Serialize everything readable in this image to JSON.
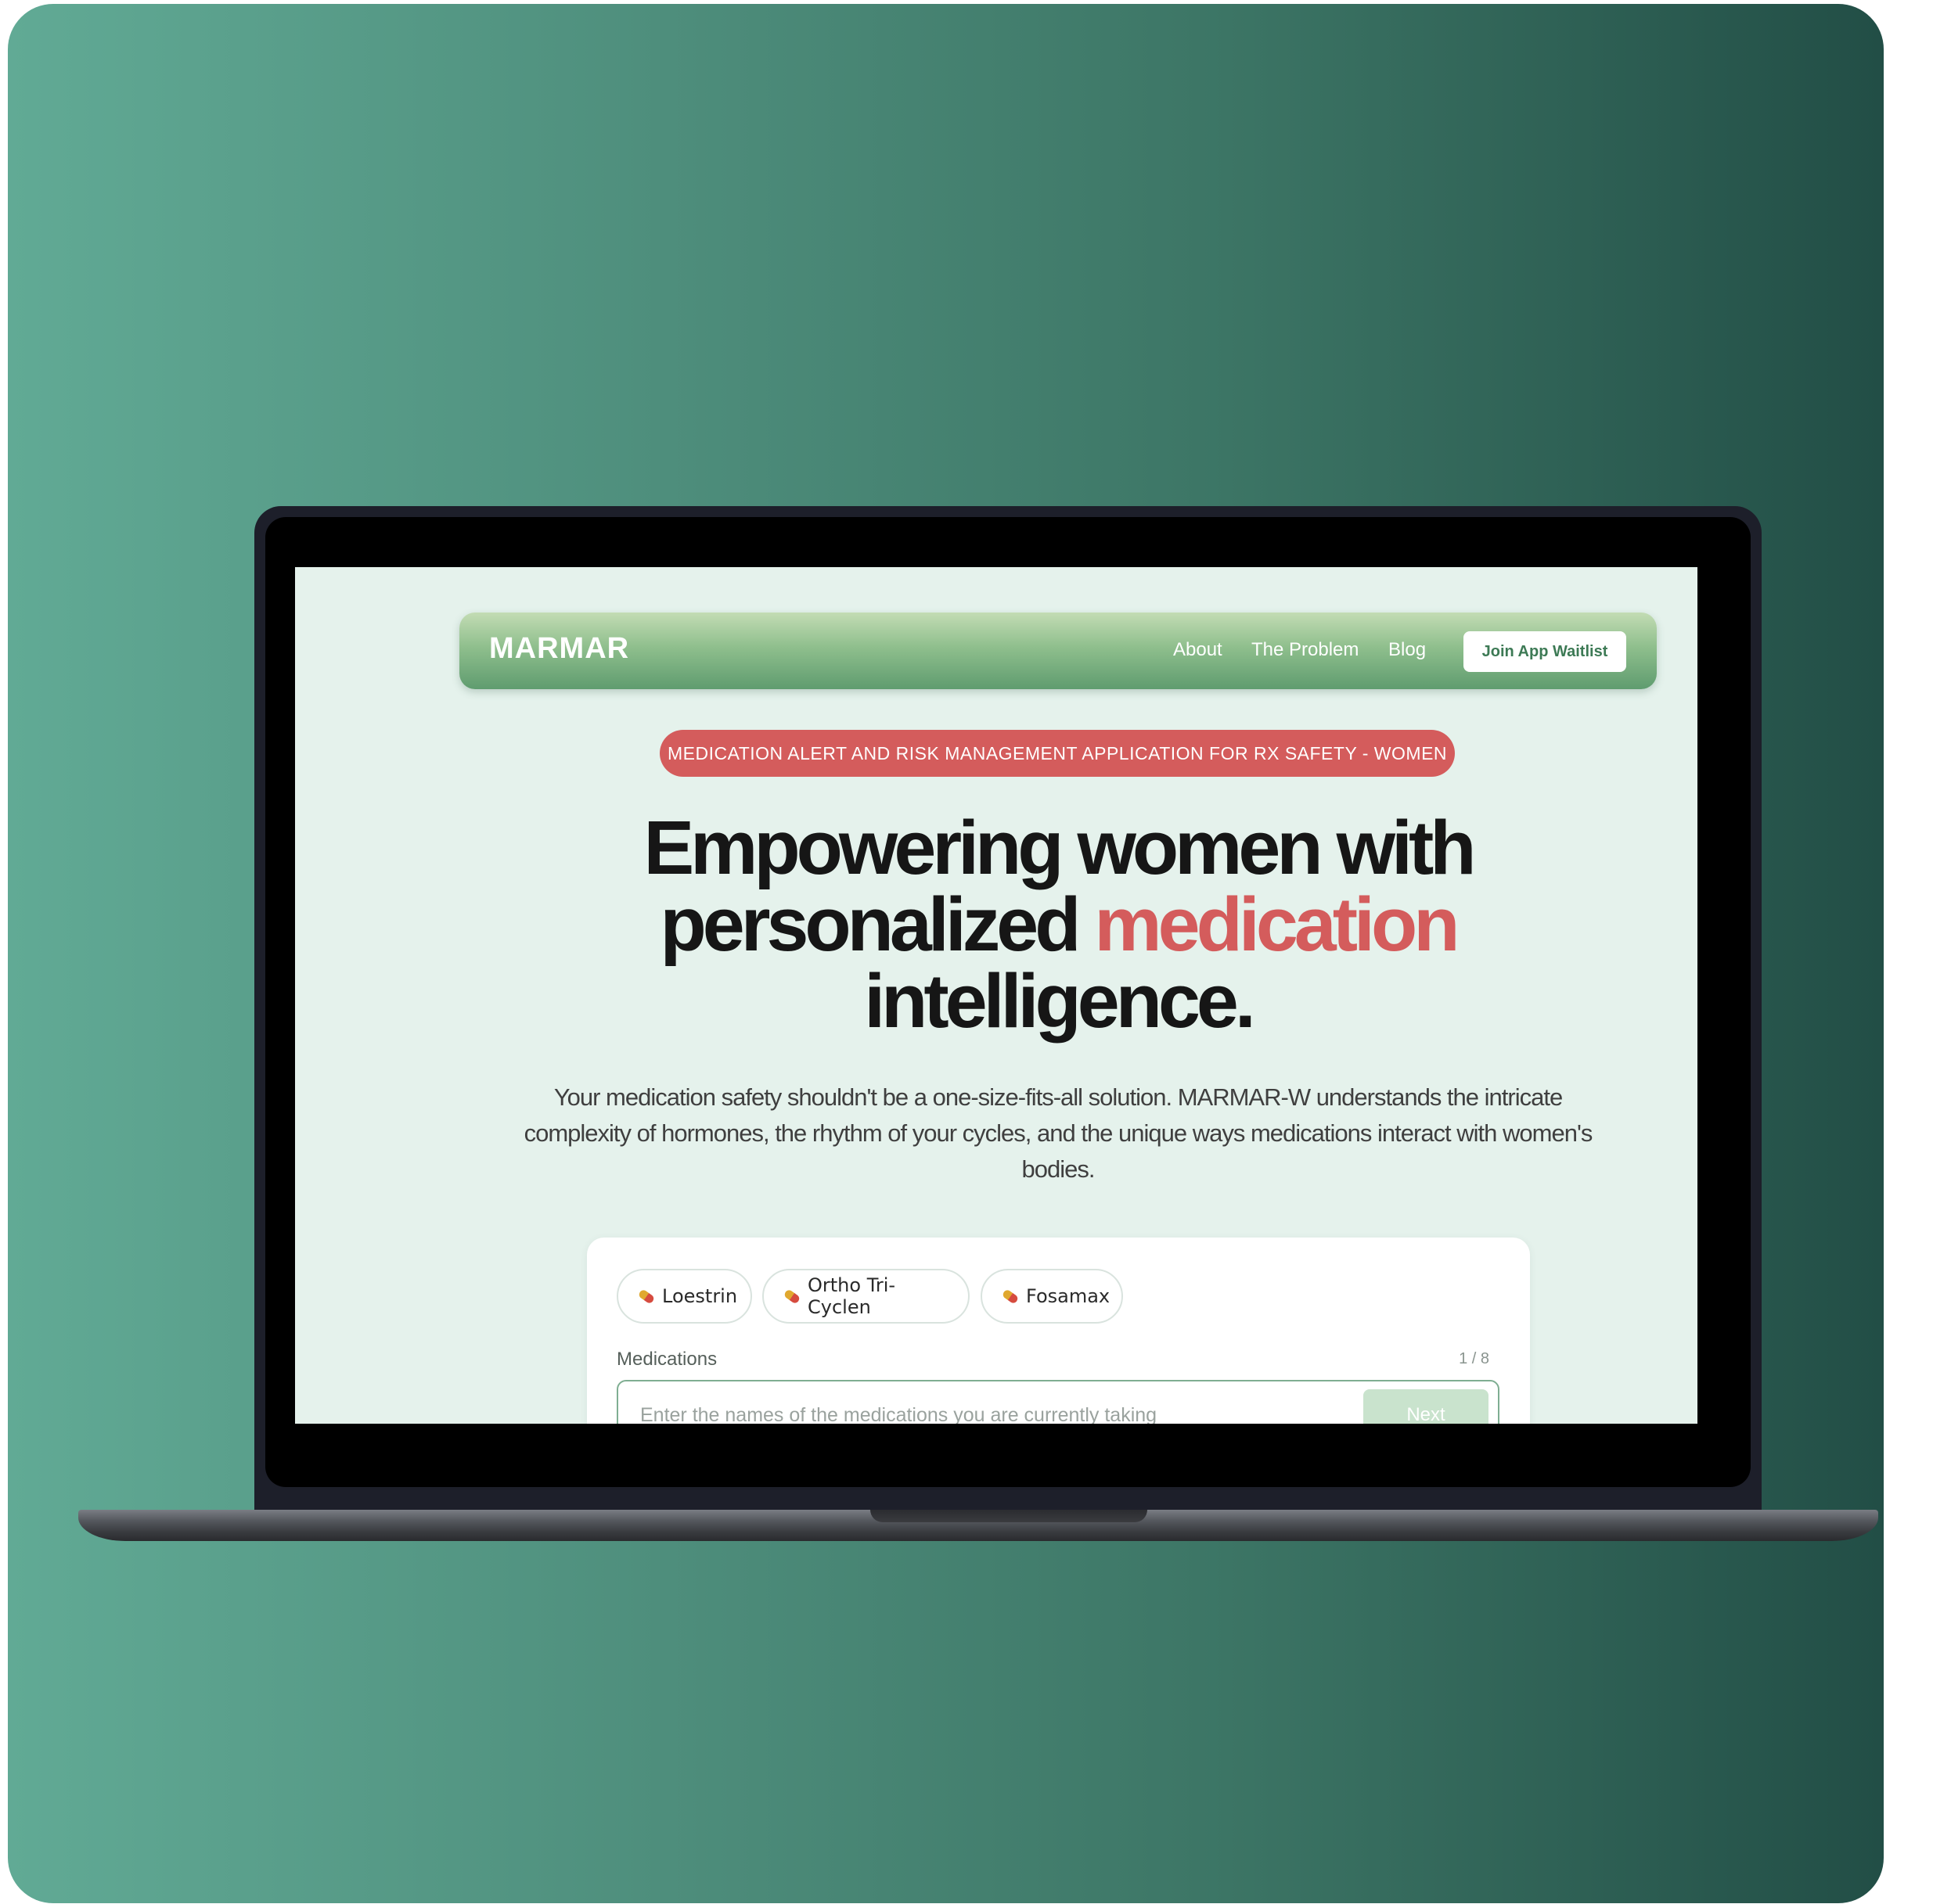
{
  "nav": {
    "logo": "MARMAR",
    "links": [
      "About",
      "The Problem",
      "Blog"
    ],
    "cta": "Join App Waitlist"
  },
  "hero": {
    "badge": "MEDICATION ALERT AND RISK MANAGEMENT APPLICATION FOR RX SAFETY - WOMEN",
    "headline_part1": "Empowering women with personalized ",
    "headline_accent": "medication",
    "headline_part2": " intelligence.",
    "subtitle": "Your medication safety shouldn't be a one-size-fits-all solution. MARMAR-W understands the intricate complexity of hormones, the rhythm of your cycles, and the unique ways medications interact with women's bodies."
  },
  "form": {
    "chips": [
      "Loestrin",
      "Ortho Tri-Cyclen",
      "Fosamax"
    ],
    "chip_icon": "pill-icon",
    "label": "Medications",
    "step": "1 / 8",
    "placeholder": "Enter the names of the medications you are currently taking",
    "next_label": "Next"
  },
  "colors": {
    "accent_red": "#d45c5c",
    "brand_green": "#5f9c6f",
    "screen_bg": "#e5f2ec"
  }
}
